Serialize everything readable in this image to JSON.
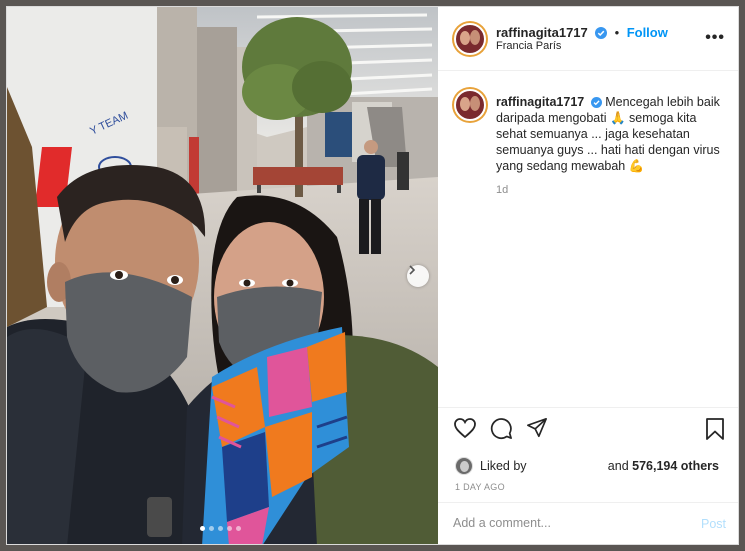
{
  "post": {
    "username": "raffinagita1717",
    "verified": true,
    "follow_label": "Follow",
    "location": "Francia París",
    "caption_username": "raffinagita1717",
    "caption_text": "Mencegah lebih baik daripada mengobati 🙏 semoga kita sehat semuanya ... jaga kesehatan semuanya guys ... hati hati dengan virus yang sedang mewabah 💪",
    "caption_time": "1d",
    "liked_by_label": "Liked by",
    "likes_prefix": "and ",
    "likes_count": "576,194 others",
    "posted_ago": "1 DAY AGO",
    "comment_placeholder": "Add a comment...",
    "post_label": "Post"
  },
  "carousel": {
    "count": 5,
    "active_index": 0
  },
  "photo": {
    "wall_sign_text": "Y TEAM"
  },
  "colors": {
    "accent": "#0095f6",
    "verified": "#3897f0",
    "scarf_orange": "#f07a1e",
    "scarf_blue": "#2f8fd8",
    "scarf_pink": "#e0559a",
    "mask": "#5c5f63"
  },
  "icons": {
    "like": "heart-icon",
    "comment": "comment-icon",
    "share": "paper-plane-icon",
    "save": "bookmark-icon",
    "more": "more-options-icon",
    "next": "chevron-right-icon"
  }
}
